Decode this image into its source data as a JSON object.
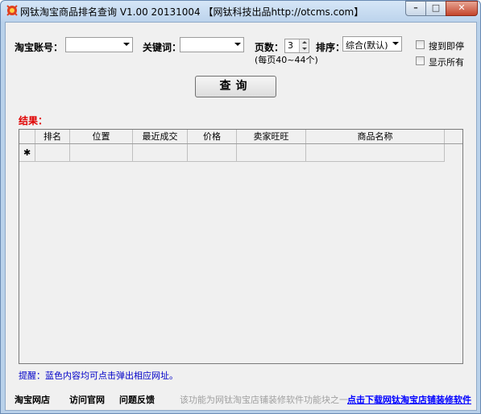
{
  "window": {
    "title": "网钛淘宝商品排名查询 V1.00 20131004 【网钛科技出品http://otcms.com】",
    "min_label": "–",
    "max_label": "□",
    "close_label": "✕"
  },
  "form": {
    "account_label": "淘宝账号：",
    "account_value": "",
    "keyword_label": "关键词：",
    "keyword_value": "",
    "pages_label": "页数：",
    "pages_value": "3",
    "pages_note": "(每页40~44个)",
    "sort_label": "排序：",
    "sort_value": "综合(默认)",
    "stop_on_found_label": "搜到即停",
    "show_all_label": "显示所有",
    "query_button": "查询"
  },
  "results": {
    "label": "结果：",
    "columns": [
      "排名",
      "位置",
      "最近成交",
      "价格",
      "卖家旺旺",
      "商品名称"
    ],
    "new_row_marker": "✱"
  },
  "tip": "提醒：蓝色内容均可点击弹出相应网址。",
  "footer": {
    "link1": "淘宝网店",
    "link2": "访问官网",
    "link3": "问题反馈",
    "info": "该功能为网钛淘宝店铺装修软件功能块之一",
    "download_link": "点击下载网钛淘宝店铺装修软件"
  }
}
